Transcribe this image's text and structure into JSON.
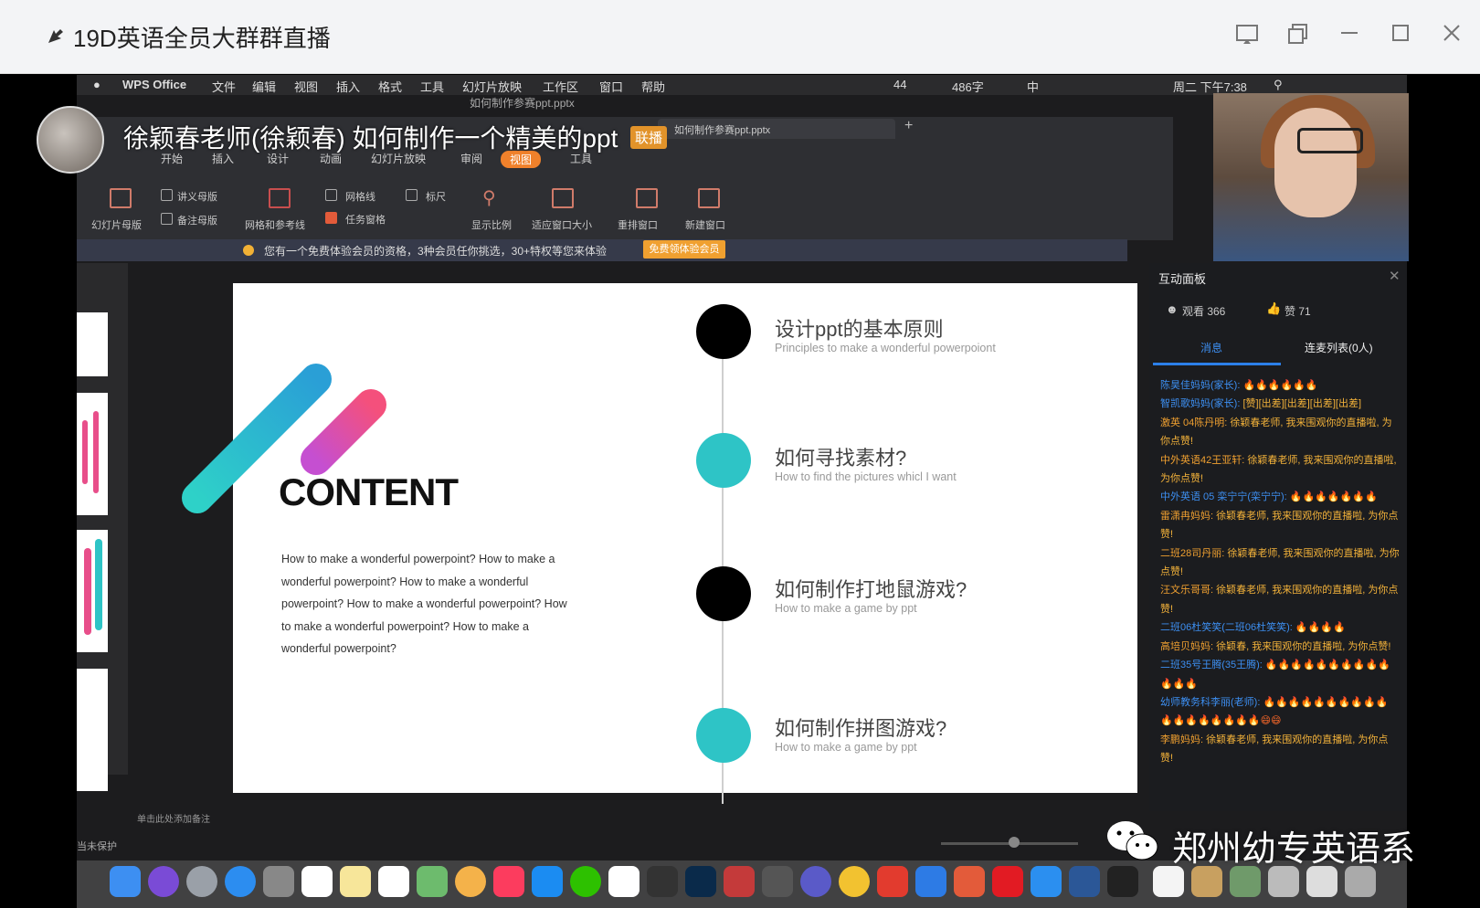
{
  "window": {
    "title": "19D英语全员大群群直播"
  },
  "mac_menubar": {
    "items": [
      "WPS Office",
      "文件",
      "编辑",
      "视图",
      "插入",
      "格式",
      "工具",
      "幻灯片放映",
      "工作区",
      "窗口",
      "帮助"
    ],
    "battery": "44",
    "net": "486字",
    "ime": "中",
    "clock": "周二 下午7:38"
  },
  "document": {
    "title": "如何制作参赛ppt.pptx",
    "tab": "如何制作参赛ppt.pptx"
  },
  "live": {
    "title": "徐颖春老师(徐颖春) 如何制作一个精美的ppt",
    "badge": "联播"
  },
  "ribbon": {
    "tabs": [
      "开始",
      "插入",
      "设计",
      "动画",
      "幻灯片放映",
      "审阅",
      "视图",
      "工具"
    ],
    "active_tab": "视图",
    "tools": {
      "slide_master": "幻灯片母版",
      "handout_master": "讲义母版",
      "notes_master": "备注母版",
      "grid_guides": "网格和参考线",
      "gridlines": "网格线",
      "ruler": "标尺",
      "task_pane": "任务窗格",
      "zoom": "显示比例",
      "fit_window": "适应窗口大小",
      "rearrange": "重排窗口",
      "new_window": "新建窗口"
    }
  },
  "notice": {
    "text": "您有一个免费体验会员的资格，3种会员任你挑选，30+特权等您来体验",
    "button": "免费领体验会员"
  },
  "slide": {
    "heading": "CONTENT",
    "body": "How to make a wonderful powerpoint? How to make a wonderful powerpoint? How to make a wonderful powerpoint? How to make a wonderful powerpoint? How to make a wonderful powerpoint? How to make a wonderful powerpoint?",
    "items": [
      {
        "title": "设计ppt的基本原则",
        "sub": "Principles to make a wonderful powerpoiont",
        "color": "#000000"
      },
      {
        "title": "如何寻找素材?",
        "sub": "How to find the pictures whicl I want",
        "color": "#2ec4c6"
      },
      {
        "title": "如何制作打地鼠游戏?",
        "sub": "How to make a game by ppt",
        "color": "#000000"
      },
      {
        "title": "如何制作拼图游戏?",
        "sub": "How to make a game by ppt",
        "color": "#2ec4c6"
      }
    ]
  },
  "notes_hint": "单击此处添加备注",
  "status": "当未保护",
  "panel": {
    "title": "互动面板",
    "viewers": "观看 366",
    "likes": "赞 71",
    "tabs": [
      "消息",
      "连麦列表(0人)"
    ],
    "messages": [
      {
        "name": "陈昊佳妈妈(家长):",
        "text": "🔥🔥🔥🔥🔥🔥",
        "nc": "b"
      },
      {
        "name": "智凯歌妈妈(家长):",
        "text": "[赞][出差][出差][出差][出差]",
        "nc": "b"
      },
      {
        "name": "激英 04陈丹明:",
        "text": "徐颖春老师, 我来围观你的直播啦, 为你点赞!",
        "nc": "o"
      },
      {
        "name": "中外英语42王亚轩:",
        "text": "徐颖春老师, 我来围观你的直播啦, 为你点赞!",
        "nc": "o"
      },
      {
        "name": "中外英语 05 栾宁宁(栾宁宁):",
        "text": "🔥🔥🔥🔥🔥🔥🔥",
        "nc": "b"
      },
      {
        "name": "雷潇冉妈妈:",
        "text": "徐颖春老师, 我来围观你的直播啦, 为你点赞!",
        "nc": "o"
      },
      {
        "name": "二班28司丹丽:",
        "text": "徐颖春老师, 我来围观你的直播啦, 为你点赞!",
        "nc": "o"
      },
      {
        "name": "汪文乐哥哥:",
        "text": "徐颖春老师, 我来围观你的直播啦, 为你点赞!",
        "nc": "o"
      },
      {
        "name": "二班06杜笑笑(二班06杜笑笑):",
        "text": "🔥🔥🔥🔥",
        "nc": "b"
      },
      {
        "name": "高培贝妈妈:",
        "text": "徐颖春, 我来围观你的直播啦, 为你点赞!",
        "nc": "o"
      },
      {
        "name": "二班35号王腾(35王腾):",
        "text": "🔥🔥🔥🔥🔥🔥🔥🔥🔥🔥🔥🔥🔥",
        "nc": "b"
      },
      {
        "name": "幼师教务科李丽(老师):",
        "text": "🔥🔥🔥🔥🔥🔥🔥🔥🔥🔥🔥🔥🔥🔥🔥🔥🔥🔥😄😄",
        "nc": "b"
      },
      {
        "name": "李鹏妈妈:",
        "text": "徐颖春老师, 我来围观你的直播啦, 为你点赞!",
        "nc": "o"
      }
    ]
  },
  "watermark": "郑州幼专英语系"
}
